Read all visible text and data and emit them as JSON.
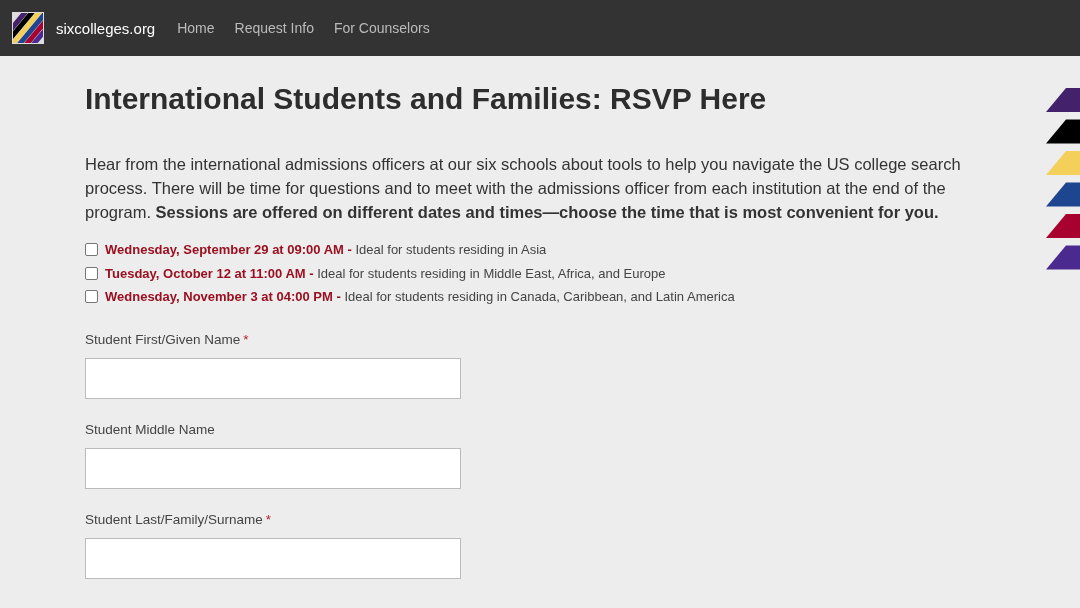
{
  "nav": {
    "brand": "sixcolleges.org",
    "links": [
      "Home",
      "Request Info",
      "For Counselors"
    ]
  },
  "title": "International Students and Families: RSVP Here",
  "intro": "Hear from the international admissions officers at our six schools about tools to help you navigate the US college search process. There will be time for questions and to meet with the admissions officer from each institution at the end of the program. **Sessions are offered on different dates and times—choose the time that is most convenient for you.**",
  "sessions": [
    {
      "label": "**Wednesday, September 29 at 09:00 AM -** Ideal for students residing in Asia",
      "checked": false
    },
    {
      "label": "**Tuesday, October 12 at 11:00 AM -** Ideal for students residing in Middle East, Africa, and Europe",
      "checked": false
    },
    {
      "label": "**Wednesday, November 3 at 04:00 PM -** Ideal for students residing in Canada, Caribbean, and Latin America",
      "checked": false
    }
  ],
  "fields": [
    {
      "label": "Student First/Given Name",
      "required_mark": "*"
    },
    {
      "label": "Student Middle Name"
    },
    {
      "label": "Student Last/Family/Surname",
      "required_mark": "*"
    }
  ]
}
